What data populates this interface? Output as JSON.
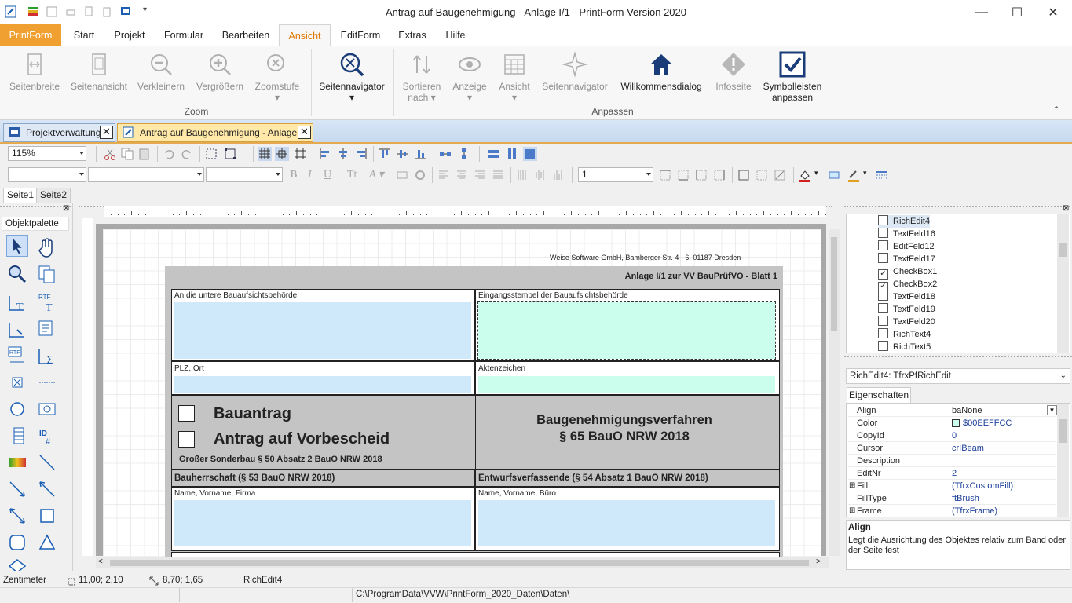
{
  "window": {
    "title": "Antrag auf Baugenehmigung - Anlage I/1 - PrintForm Version 2020"
  },
  "menu": {
    "file": "PrintForm",
    "items": [
      "Start",
      "Projekt",
      "Formular",
      "Bearbeiten",
      "Ansicht",
      "EditForm",
      "Extras",
      "Hilfe"
    ]
  },
  "ribbon": {
    "buttons": [
      {
        "label": "Seitenbreite",
        "icon": "page-width-icon"
      },
      {
        "label": "Seitenansicht",
        "icon": "page-view-icon"
      },
      {
        "label": "Verkleinern",
        "icon": "zoom-out-icon"
      },
      {
        "label": "Vergrößern",
        "icon": "zoom-in-icon"
      },
      {
        "label": "Zoomstufe",
        "icon": "zoom-level-icon"
      },
      {
        "label": "Seitennavigator",
        "icon": "page-navigator-icon"
      },
      {
        "label": "Sortieren nach",
        "icon": "sort-icon"
      },
      {
        "label": "Anzeige",
        "icon": "eye-icon"
      },
      {
        "label": "Ansicht",
        "icon": "view-grid-icon"
      },
      {
        "label": "Seitennavigator",
        "icon": "compass-icon"
      },
      {
        "label": "Willkommensdialog",
        "icon": "home-icon"
      },
      {
        "label": "Infoseite",
        "icon": "info-icon"
      },
      {
        "label": "Symbolleisten anpassen",
        "icon": "checkbox-icon"
      }
    ],
    "groups": {
      "zoom": "Zoom",
      "anpassen": "Anpassen"
    }
  },
  "doctabs": [
    "Projektverwaltung",
    "Antrag auf Baugenehmigung - Anlage I/1"
  ],
  "toolbar": {
    "zoom": "115%",
    "font_size": "1"
  },
  "pagetabs": [
    "Seite1",
    "Seite2"
  ],
  "palette": {
    "title": "Objektpalette"
  },
  "form": {
    "company": "Weise Software GmbH, Bamberger Str. 4 - 6, 01187 Dresden",
    "heading": "Anlage I/1 zur VV BauPrüfVO - Blatt 1",
    "field1": "An die untere Bauaufsichtsbehörde",
    "field2": "Eingangsstempel der Bauaufsichtsbehörde",
    "field3": "PLZ, Ort",
    "field4": "Aktenzeichen",
    "cb1": "Bauantrag",
    "cb2": "Antrag auf Vorbescheid",
    "sonderbau": "Großer Sonderbau § 50 Absatz 2 BauO NRW 2018",
    "verfahren1": "Baugenehmigungsverfahren",
    "verfahren2": "§ 65 BauO NRW 2018",
    "bauherr": "Bauherrschaft (§ 53 BauO NRW 2018)",
    "entwurf": "Entwurfsverfassende (§ 54 Absatz 1 BauO NRW 2018)",
    "name1": "Name, Vorname, Firma",
    "name2": "Name, Vorname, Büro"
  },
  "tree": [
    "RichEdit4",
    "TextFeld16",
    "EditFeld12",
    "TextFeld17",
    "CheckBox1",
    "CheckBox2",
    "TextFeld18",
    "TextFeld19",
    "TextFeld20",
    "RichText4",
    "RichText5"
  ],
  "inspector": {
    "selected": "RichEdit4: TfrxPfRichEdit",
    "tab": "Eigenschaften",
    "props": [
      {
        "k": "Align",
        "v": "baNone"
      },
      {
        "k": "Color",
        "v": "$00EEFFCC"
      },
      {
        "k": "CopyId",
        "v": "0"
      },
      {
        "k": "Cursor",
        "v": "crIBeam"
      },
      {
        "k": "Description",
        "v": ""
      },
      {
        "k": "EditNr",
        "v": "2"
      },
      {
        "k": "Fill",
        "v": "(TfrxCustomFill)"
      },
      {
        "k": "FillType",
        "v": "ftBrush"
      },
      {
        "k": "Frame",
        "v": "(TfrxFrame)"
      }
    ],
    "help_title": "Align",
    "help_text": "Legt die Ausrichtung des Objektes relativ zum Band oder der Seite fest"
  },
  "status": {
    "unit": "Zentimeter",
    "pos": "11,00; 2,10",
    "size": "8,70; 1,65",
    "obj": "RichEdit4",
    "path": "C:\\ProgramData\\VVW\\PrintForm_2020_Daten\\Daten\\"
  },
  "colors": {
    "accent": "#f0a030",
    "field_blue": "#cfe8fa",
    "field_green": "#ccfeee",
    "navy": "#1a3d7a"
  }
}
